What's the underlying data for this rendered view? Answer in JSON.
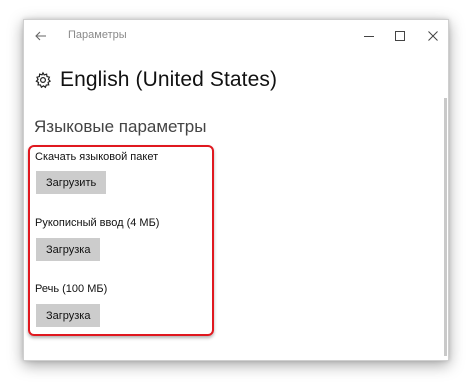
{
  "window": {
    "title": "Параметры",
    "controls": {
      "back": "back-arrow",
      "minimize": "minimize",
      "maximize": "maximize",
      "close": "close"
    }
  },
  "page": {
    "title": "English (United States)",
    "icon": "gear-icon"
  },
  "section": {
    "title": "Языковые параметры"
  },
  "items": [
    {
      "label": "Скачать языковой пакет",
      "button": "Загрузить"
    },
    {
      "label": "Рукописный ввод (4 МБ)",
      "button": "Загрузка"
    },
    {
      "label": "Речь (100 МБ)",
      "button": "Загрузка"
    }
  ],
  "colors": {
    "highlight": "#e0181f",
    "button_bg": "#cccccc"
  }
}
